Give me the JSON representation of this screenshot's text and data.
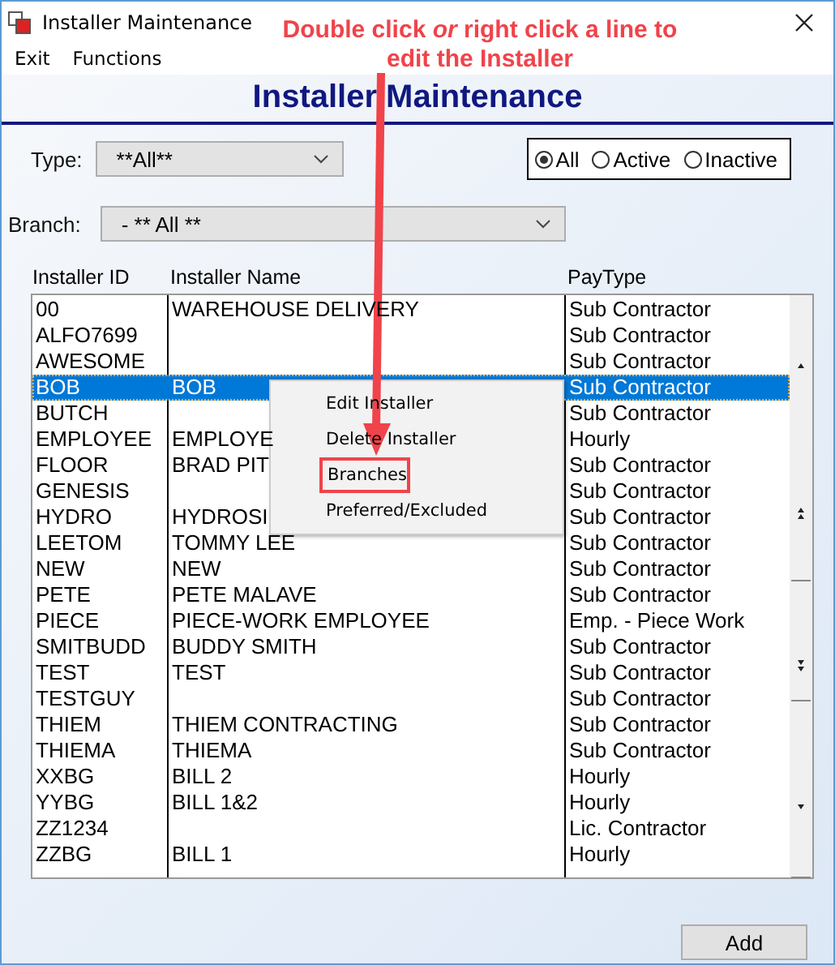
{
  "window": {
    "title": "Installer Maintenance"
  },
  "menu": [
    {
      "label": "Exit"
    },
    {
      "label": "Functions"
    }
  ],
  "annotation": {
    "text": "Double click *or* right click a line to edit the Installer"
  },
  "heading": "Installer Maintenance",
  "type_filter": {
    "label": "Type:",
    "value": "**All**"
  },
  "status_filter": [
    {
      "label": "All",
      "selected": true
    },
    {
      "label": "Active",
      "selected": false
    },
    {
      "label": "Inactive",
      "selected": false
    }
  ],
  "branch_filter": {
    "label": "Branch:",
    "value": "- ** All **"
  },
  "table": {
    "columns": [
      "Installer ID",
      "Installer Name",
      "PayType"
    ],
    "rows": [
      {
        "id": "00",
        "name": "WAREHOUSE DELIVERY",
        "paytype": "Sub Contractor",
        "selected": false
      },
      {
        "id": "ALFO7699",
        "name": "",
        "paytype": "Sub Contractor",
        "selected": false
      },
      {
        "id": "AWESOME",
        "name": "",
        "paytype": "Sub Contractor",
        "selected": false
      },
      {
        "id": "BOB",
        "name": "BOB",
        "paytype": "Sub Contractor",
        "selected": true
      },
      {
        "id": "BUTCH",
        "name": "",
        "paytype": "Sub Contractor",
        "selected": false
      },
      {
        "id": "EMPLOYEE",
        "name": "EMPLOYE",
        "paytype": "Hourly",
        "selected": false
      },
      {
        "id": "FLOOR",
        "name": "BRAD PIT",
        "paytype": "Sub Contractor",
        "selected": false
      },
      {
        "id": "GENESIS",
        "name": "",
        "paytype": "Sub Contractor",
        "selected": false
      },
      {
        "id": "HYDRO",
        "name": "HYDROSI",
        "paytype": "Sub Contractor",
        "selected": false
      },
      {
        "id": "LEETOM",
        "name": "TOMMY LEE",
        "paytype": "Sub Contractor",
        "selected": false
      },
      {
        "id": "NEW",
        "name": "NEW",
        "paytype": "Sub Contractor",
        "selected": false
      },
      {
        "id": "PETE",
        "name": "PETE MALAVE",
        "paytype": "Sub Contractor",
        "selected": false
      },
      {
        "id": "PIECE",
        "name": "PIECE-WORK EMPLOYEE",
        "paytype": "Emp. - Piece Work",
        "selected": false
      },
      {
        "id": "SMITBUDD",
        "name": "BUDDY SMITH",
        "paytype": "Sub Contractor",
        "selected": false
      },
      {
        "id": "TEST",
        "name": "TEST",
        "paytype": "Sub Contractor",
        "selected": false
      },
      {
        "id": "TESTGUY",
        "name": "",
        "paytype": "Sub Contractor",
        "selected": false
      },
      {
        "id": "THIEM",
        "name": "THIEM CONTRACTING",
        "paytype": "Sub Contractor",
        "selected": false
      },
      {
        "id": "THIEMA",
        "name": "THIEMA",
        "paytype": "Sub Contractor",
        "selected": false
      },
      {
        "id": "XXBG",
        "name": "BILL 2",
        "paytype": "Hourly",
        "selected": false
      },
      {
        "id": "YYBG",
        "name": "BILL 1&2",
        "paytype": "Hourly",
        "selected": false
      },
      {
        "id": "ZZ1234",
        "name": "",
        "paytype": "Lic. Contractor",
        "selected": false
      },
      {
        "id": "ZZBG",
        "name": "BILL 1",
        "paytype": "Hourly",
        "selected": false
      }
    ]
  },
  "context_menu": [
    {
      "label": "Edit Installer",
      "highlighted": false
    },
    {
      "label": "Delete Installer",
      "highlighted": false
    },
    {
      "label": "Branches",
      "highlighted": true
    },
    {
      "label": "Preferred/Excluded",
      "highlighted": false
    }
  ],
  "buttons": [
    {
      "label": "Add"
    }
  ]
}
